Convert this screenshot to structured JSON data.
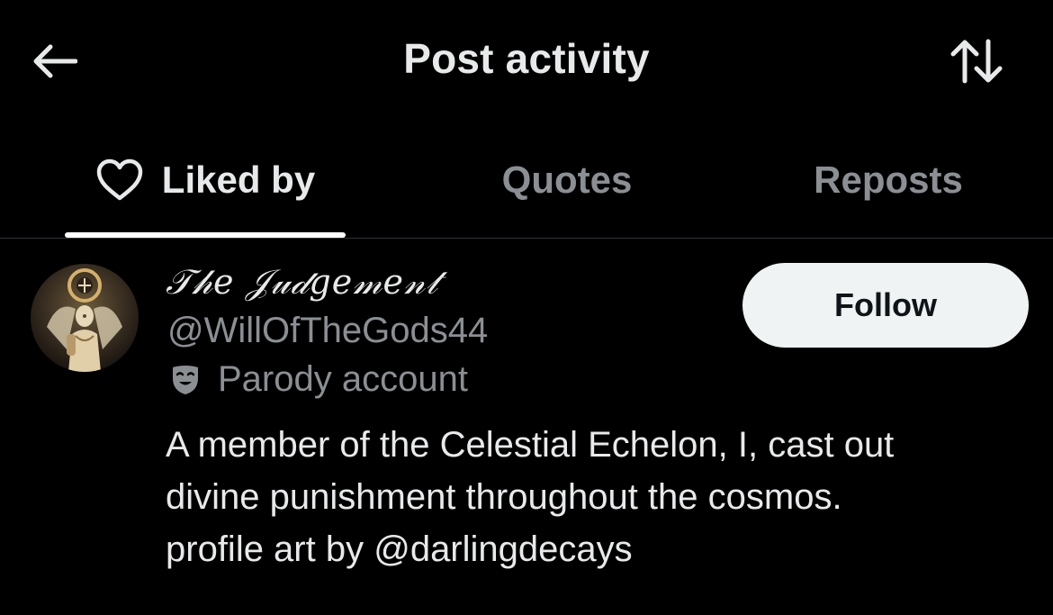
{
  "header": {
    "title": "Post activity",
    "back_icon": "arrow-left-icon",
    "sort_icon": "sort-arrows-icon"
  },
  "tabs": [
    {
      "label": "Liked by",
      "icon": "heart-icon",
      "active": true
    },
    {
      "label": "Quotes",
      "active": false
    },
    {
      "label": "Reposts",
      "active": false
    }
  ],
  "user": {
    "display_name": "𝒯𝒽𝑒 𝒥𝓊𝒹𝑔𝑒𝓂𝑒𝓃𝓉",
    "handle": "@WillOfTheGods44",
    "badge_label": "Parody account",
    "badge_icon": "theater-mask-icon",
    "follow_label": "Follow",
    "bio_lines": [
      "A member of the Celestial Echelon, I, cast out",
      "divine punishment throughout the cosmos.",
      "profile art by @darlingdecays"
    ]
  },
  "colors": {
    "background": "#000000",
    "primary_text": "#e7e9ea",
    "secondary_text": "#8b8f94",
    "button_bg": "#eff3f4",
    "button_text": "#0f1419",
    "divider": "#2f3336"
  }
}
